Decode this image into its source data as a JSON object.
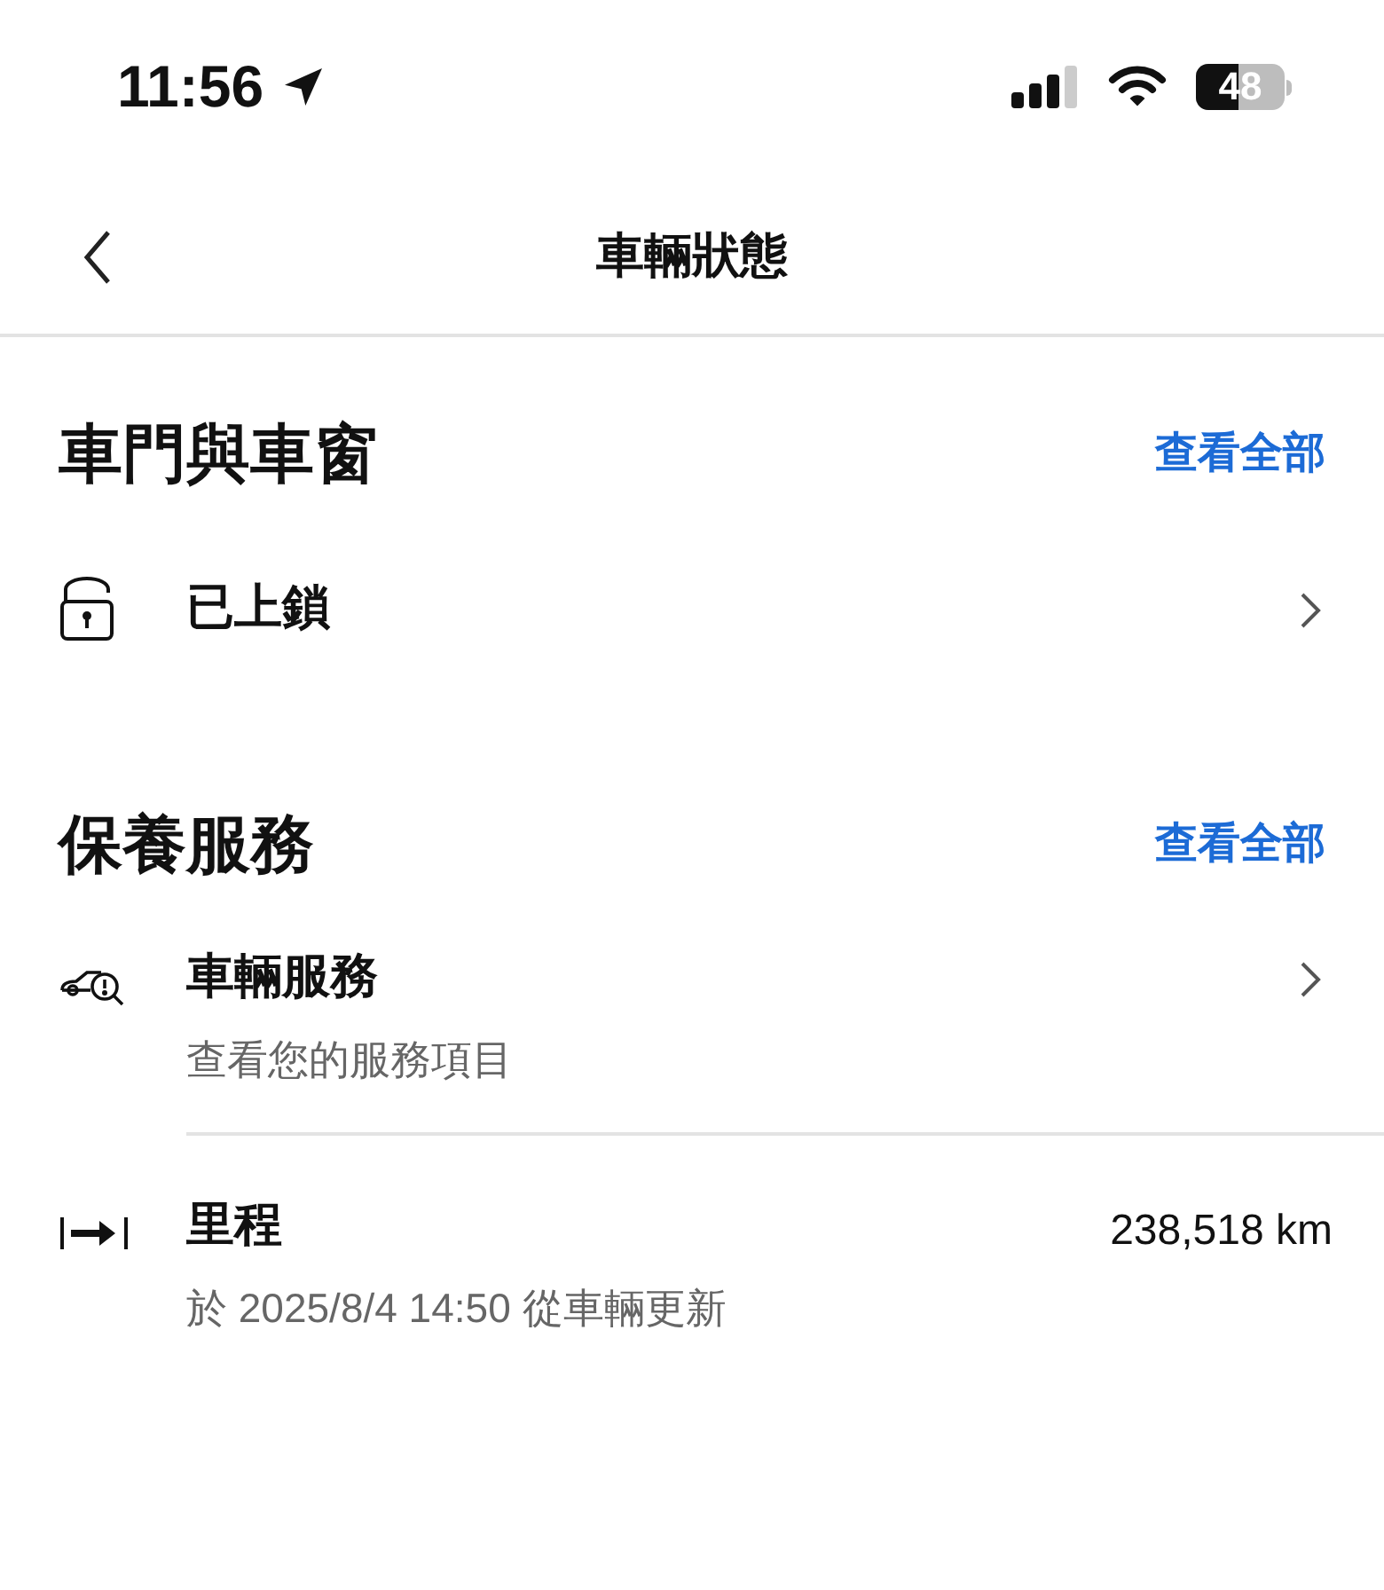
{
  "status_bar": {
    "time": "11:56",
    "battery": "48"
  },
  "header": {
    "title": "車輛狀態"
  },
  "sections": [
    {
      "title": "車門與車窗",
      "link": "查看全部",
      "rows": [
        {
          "kind": "lock",
          "title": "已上鎖",
          "chevron": true
        }
      ]
    },
    {
      "title": "保養服務",
      "link": "查看全部",
      "rows": [
        {
          "kind": "service",
          "title": "車輛服務",
          "subtitle": "查看您的服務項目",
          "chevron": true
        },
        {
          "kind": "odometer",
          "title": "里程",
          "subtitle": "於 2025/8/4 14:50 從車輛更新",
          "value": "238,518 km",
          "chevron": false
        }
      ]
    }
  ]
}
